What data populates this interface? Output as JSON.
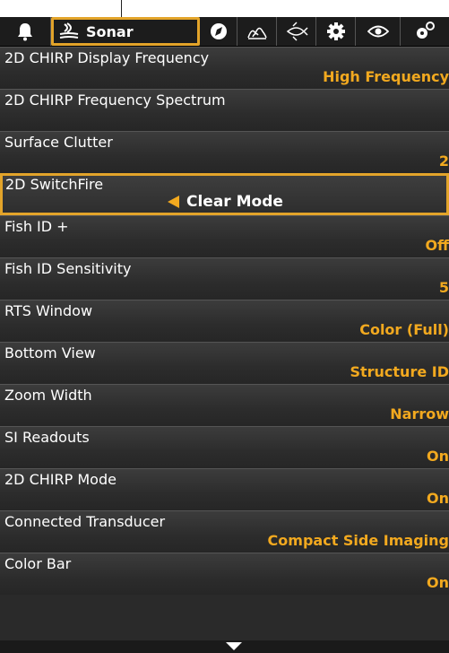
{
  "tabs": {
    "active_label": "Sonar",
    "icons": [
      "bell-icon",
      "sonar-icon",
      "navigation-icon",
      "chart-icon",
      "fish-icon",
      "gear-icon",
      "eye-icon",
      "accessories-icon"
    ]
  },
  "rows": [
    {
      "name": "2D CHIRP Display Frequency",
      "value": "High Frequency"
    },
    {
      "name": "2D CHIRP Frequency Spectrum",
      "value": ""
    },
    {
      "name": "Surface Clutter",
      "value": "2"
    },
    {
      "name": "2D SwitchFire",
      "value": "Clear Mode"
    },
    {
      "name": "Fish ID +",
      "value": "Off"
    },
    {
      "name": "Fish ID Sensitivity",
      "value": "5"
    },
    {
      "name": "RTS Window",
      "value": "Color (Full)"
    },
    {
      "name": "Bottom View",
      "value": "Structure ID"
    },
    {
      "name": "Zoom Width",
      "value": "Narrow"
    },
    {
      "name": "SI Readouts",
      "value": "On"
    },
    {
      "name": "2D CHIRP Mode",
      "value": "On"
    },
    {
      "name": "Connected Transducer",
      "value": "Compact Side Imaging"
    },
    {
      "name": "Color Bar",
      "value": "On"
    }
  ],
  "colors": {
    "accent": "#e3a42a",
    "value_text": "#f2a91f",
    "background": "#2a2a2a"
  }
}
